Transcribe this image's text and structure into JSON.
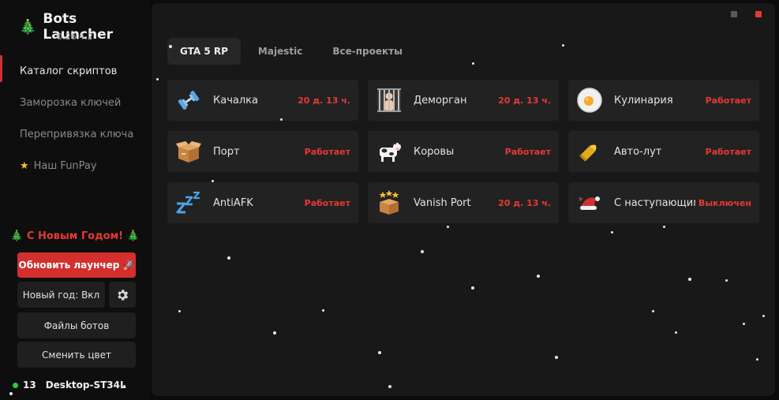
{
  "app": {
    "title": "Bots Launcher",
    "version": "0.26.4.2",
    "accent": "#d32f2f"
  },
  "sidebar": {
    "items": [
      {
        "label": "Каталог скриптов"
      },
      {
        "label": "Заморозка ключей"
      },
      {
        "label": "Перепривязка ключа"
      },
      {
        "label": "Наш FunPay"
      }
    ],
    "greeting": "🎄 С Новым Годом! 🎄",
    "update_button": "Обновить лаунчер 🚀",
    "newyear_toggle": "Новый год: Вкл",
    "bot_files_button": "Файлы ботов",
    "change_color_button": "Сменить цвет",
    "online_count": "13",
    "machine_name": "Desktop-ST34L"
  },
  "tabs": [
    {
      "label": "GTA 5 RP"
    },
    {
      "label": "Majestic"
    },
    {
      "label": "Все-проекты"
    }
  ],
  "scripts": [
    {
      "name": "Качалка",
      "status": "20 д. 13 ч.",
      "icon": "dumbbell-icon"
    },
    {
      "name": "Деморган",
      "status": "20 д. 13 ч.",
      "icon": "jail-icon"
    },
    {
      "name": "Кулинария",
      "status": "Работает",
      "icon": "fried-egg-icon"
    },
    {
      "name": "Порт",
      "status": "Работает",
      "icon": "box-icon"
    },
    {
      "name": "Коровы",
      "status": "Работает",
      "icon": "cow-icon"
    },
    {
      "name": "Авто-лут",
      "status": "Работает",
      "icon": "bullet-icon"
    },
    {
      "name": "AntiAFK",
      "status": "Работает",
      "icon": "sleep-icon"
    },
    {
      "name": "Vanish Port",
      "status": "20 д. 13 ч.",
      "icon": "stars-box-icon"
    },
    {
      "name": "С наступающим",
      "status": "Выключен",
      "icon": "santa-hat-icon"
    }
  ]
}
